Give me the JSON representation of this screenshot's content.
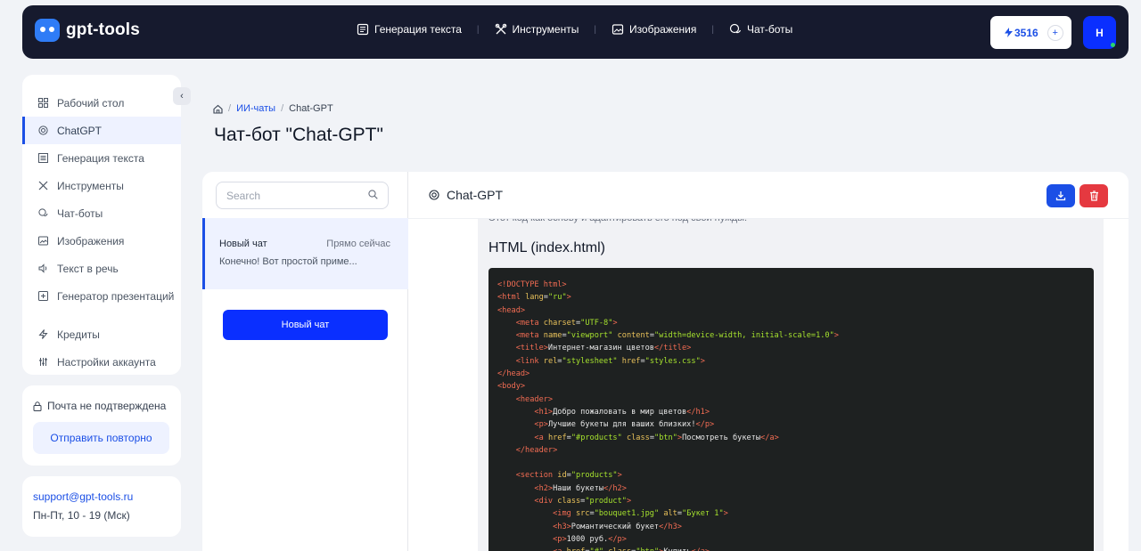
{
  "topbar": {
    "brand": "gpt-tools",
    "nav": [
      {
        "label": "Генерация текста",
        "icon": "document-icon"
      },
      {
        "label": "Инструменты",
        "icon": "tools-icon"
      },
      {
        "label": "Изображения",
        "icon": "image-icon"
      },
      {
        "label": "Чат-боты",
        "icon": "chat-icon"
      }
    ],
    "credits": "3516",
    "credits_plus": "+",
    "avatar_letter": "Н"
  },
  "sidebar": {
    "items": [
      {
        "label": "Рабочий стол",
        "icon": "dashboard-icon"
      },
      {
        "label": "ChatGPT",
        "icon": "openai-icon"
      },
      {
        "label": "Генерация текста",
        "icon": "document-icon"
      },
      {
        "label": "Инструменты",
        "icon": "tools-icon"
      },
      {
        "label": "Чат-боты",
        "icon": "chat-icon"
      },
      {
        "label": "Изображения",
        "icon": "image-icon"
      },
      {
        "label": "Текст в речь",
        "icon": "speaker-icon"
      },
      {
        "label": "Генератор презентаций",
        "icon": "presentation-icon"
      }
    ],
    "bottom_items": [
      {
        "label": "Кредиты",
        "icon": "lightning-icon"
      },
      {
        "label": "Настройки аккаунта",
        "icon": "settings-icon"
      }
    ],
    "collapse_symbol": "‹"
  },
  "email_notice": {
    "text": "Почта не подтверждена",
    "button": "Отправить повторно"
  },
  "support": {
    "email": "support@gpt-tools.ru",
    "hours": "Пн-Пт, 10 - 19 (Мск)"
  },
  "breadcrumb": {
    "link": "ИИ-чаты",
    "separator": "/",
    "current": "Chat-GPT"
  },
  "page_title": "Чат-бот \"Chat-GPT\"",
  "chat_list": {
    "search_placeholder": "Search",
    "entries": [
      {
        "name": "Новый чат",
        "time": "Прямо сейчас",
        "preview": "Конечно! Вот простой приме..."
      }
    ],
    "new_chat_button": "Новый чат"
  },
  "chat": {
    "title": "Chat-GPT",
    "cut_text": "Этот код как основу и адаптировать его под свои нужды.",
    "code_heading": "HTML (index.html)"
  },
  "colors": {
    "topbar": "#161a2e",
    "accent": "#1b4fe6",
    "danger": "#e53940",
    "code_bg": "#1e2121"
  }
}
